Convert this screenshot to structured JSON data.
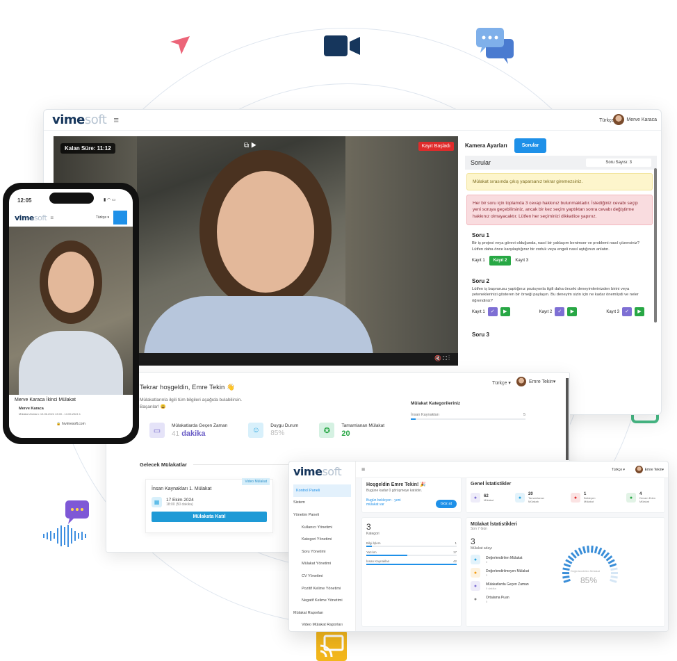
{
  "colors": {
    "accent": "#1e90e8",
    "danger": "#e02b2b",
    "success": "#28a745",
    "purple": "#7e6fd4",
    "brand": "#16365c"
  },
  "main_window": {
    "logo_bold": "vime",
    "logo_light": "soft",
    "language": "Türkçe",
    "user": "Merve Karaca",
    "timer": "Kalan Süre: 11:12",
    "recording": "Kayıt Başladı",
    "camera_tab": "Kamera Ayarları",
    "questions_tab": "Sorular",
    "panel_title": "Sorular",
    "question_count": "Soru Sayısı: 3",
    "warning_exit": "Mülakat sırasında çıkış yaparsanız tekrar giremezsiniz.",
    "warning_rules": "Her bir soru için toplamda 3 cevap hakkınız bulunmaktadır. İstediğiniz cevabı seçip yeni soruya geçebilirsiniz, ancak bir kez seçim yaptıktan sonra cevabı değiştirme hakkınız olmayacaktır. Lütfen her seçiminizi dikkatlice yapınız.",
    "questions": [
      {
        "title": "Soru 1",
        "text": "Bir iş projesi veya görevi olduğunda, nasıl bir yaklaşım benimser ve problemi nasıl çözersiniz? Lütfen daha önce karşılaştığınız bir zorluk veya engeli nasıl aştığınızı anlatın.",
        "k1": "Kayıt 1",
        "k2": "Kayıt 2",
        "k3": "Kayıt 3"
      },
      {
        "title": "Soru 2",
        "text": "Lütfen iş başvurusu yaptığınız pozisyonla ilgili daha önceki deneyimlerinizden birini veya yeteneklerinizi gösteren bir örneği paylaşın. Bu deneyim sizin için ne kadar önemliydi ve neler öğrendiniz?",
        "k1": "Kayıt 1",
        "k2": "Kayıt 2",
        "k3": "Kayıt 3"
      },
      {
        "title": "Soru 3"
      }
    ]
  },
  "phone": {
    "time": "12:05",
    "language": "Türkçe",
    "title": "Merve Karaca İkinci Mülakat",
    "name": "Merve Karaca",
    "detail": "Mülakat Zamanı: 13.06.2024 13:00 - 13.06.2024 1",
    "url": "hrvimesoft.com"
  },
  "dash1": {
    "language": "Türkçe",
    "user": "Emre Tekin",
    "greeting": "Tekrar hoşgeldin, Emre Tekin 👋",
    "sub1": "Mülakatlarınla ilgili tüm bilgileri aşağıda bulabilirsin.",
    "sub2": "Başarılar! 😀",
    "stat1_label": "Mülakatlarda Geçen Zaman",
    "stat1_value": "41",
    "stat1_unit": "dakika",
    "stat2_label": "Duygu Durum",
    "stat2_value": "85%",
    "stat3_label": "Tamamlanan Mülakat",
    "stat3_value": "20",
    "cat_title": "Mülakat Kategorileriniz",
    "cat_name": "İnsan Kaynakları",
    "cat_value": "5",
    "upcoming_title": "Gelecek Mülakatlar",
    "card_badge": "Video Mülakat",
    "card_title": "İnsan Kaynakları 1. Mülakat",
    "card_date": "17 Ekim 2024",
    "card_time": "18:00 (50 dakika)",
    "join_btn": "Mülakata Katıl"
  },
  "dash2": {
    "language": "Türkçe",
    "user": "Emre Tekin",
    "sidebar": [
      "Kontrol Paneli",
      "Sistem",
      "Yönetim Paneli",
      "Kullanıcı Yönetimi",
      "Kategori Yönetimi",
      "Soru Yönetimi",
      "Mülakat Yönetimi",
      "CV Yönetimi",
      "Pozitif Kelime Yönetimi",
      "Negatif Kelime Yönetimi",
      "Mülakat Raporları",
      "Video Mülakat Raporları"
    ],
    "welcome": "Hoşgeldin Emre Tekin! 🎉",
    "welcome_sub": "Bugüne kadar 0 görüşmeye katıldın.",
    "pending": "Bugün bekleyen",
    "pending_new": "yeni",
    "pending_sub": "mülakat var",
    "go_btn": "Göz at",
    "general_title": "Genel İstatistikler",
    "gs": [
      {
        "v": "62",
        "l": "Mülakat"
      },
      {
        "v": "20",
        "l": "Tamamlanan Mülakatı"
      },
      {
        "v": "1",
        "l": "Bekleyen Mülakat"
      },
      {
        "v": "4",
        "l": "Devam Eden Mülakat"
      }
    ],
    "cat_count": "3",
    "cat_label": "Kategori",
    "cats": [
      {
        "n": "Bilgi İşlem",
        "v": "1",
        "p": 6
      },
      {
        "n": "Yazılım",
        "v": "17",
        "p": 45
      },
      {
        "n": "İnsan Kaynakları",
        "v": "42",
        "p": 100
      }
    ],
    "mstats_title": "Mülakat İstatistikleri",
    "mstats_sub": "Son 7 Gün",
    "cand_count": "3",
    "cand_label": "Mülakat adayı",
    "items": [
      {
        "t": "Değerlendirilen Mülakat",
        "s": "0"
      },
      {
        "t": "Değerlendirilmeyen Mülakat",
        "s": "3"
      },
      {
        "t": "Mülakatlarda Geçen Zaman",
        "s": "0 dakika"
      },
      {
        "t": "Ortalama Puan",
        "s": "0"
      }
    ],
    "gauge_label": "Değerlendirilen Mülakat",
    "gauge_value": "85%",
    "gauge_fraction": 0.85
  }
}
